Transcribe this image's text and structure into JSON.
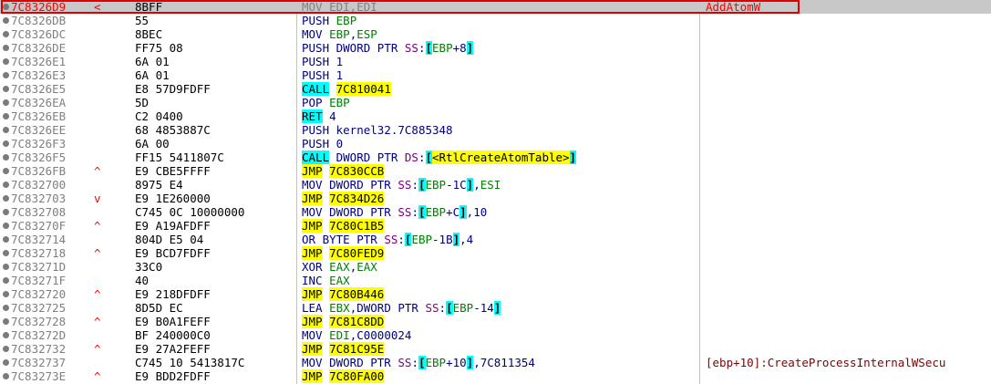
{
  "disassembly": {
    "rows": [
      {
        "addr": "7C8326D9",
        "arrow": "<",
        "bytes": "8BFF",
        "instr": "MOV EDI,EDI",
        "comment": "AddAtomW",
        "selected": true
      },
      {
        "addr": "7C8326DB",
        "arrow": "",
        "bytes": "55",
        "instr": "PUSH EBP",
        "comment": ""
      },
      {
        "addr": "7C8326DC",
        "arrow": "",
        "bytes": "8BEC",
        "instr": "MOV EBP,ESP",
        "comment": ""
      },
      {
        "addr": "7C8326DE",
        "arrow": "",
        "bytes": "FF75 08",
        "instr": "PUSH DWORD PTR SS:[EBP+8]",
        "comment": ""
      },
      {
        "addr": "7C8326E1",
        "arrow": "",
        "bytes": "6A 01",
        "instr": "PUSH 1",
        "comment": ""
      },
      {
        "addr": "7C8326E3",
        "arrow": "",
        "bytes": "6A 01",
        "instr": "PUSH 1",
        "comment": ""
      },
      {
        "addr": "7C8326E5",
        "arrow": "",
        "bytes": "E8 57D9FDFF",
        "instr": "CALL 7C810041",
        "comment": ""
      },
      {
        "addr": "7C8326EA",
        "arrow": "",
        "bytes": "5D",
        "instr": "POP EBP",
        "comment": ""
      },
      {
        "addr": "7C8326EB",
        "arrow": "",
        "bytes": "C2 0400",
        "instr": "RET 4",
        "comment": ""
      },
      {
        "addr": "7C8326EE",
        "arrow": "",
        "bytes": "68 4853887C",
        "instr": "PUSH kernel32.7C885348",
        "comment": ""
      },
      {
        "addr": "7C8326F3",
        "arrow": "",
        "bytes": "6A 00",
        "instr": "PUSH 0",
        "comment": ""
      },
      {
        "addr": "7C8326F5",
        "arrow": "",
        "bytes": "FF15 5411807C",
        "instr": "CALL DWORD PTR DS:[<RtlCreateAtomTable>]",
        "comment": ""
      },
      {
        "addr": "7C8326FB",
        "arrow": "^",
        "bytes": "E9 CBE5FFFF",
        "instr": "JMP 7C830CCB",
        "comment": ""
      },
      {
        "addr": "7C832700",
        "arrow": "",
        "bytes": "8975 E4",
        "instr": "MOV DWORD PTR SS:[EBP-1C],ESI",
        "comment": ""
      },
      {
        "addr": "7C832703",
        "arrow": "v",
        "bytes": "E9 1E260000",
        "instr": "JMP 7C834D26",
        "comment": ""
      },
      {
        "addr": "7C832708",
        "arrow": "",
        "bytes": "C745 0C 10000000",
        "instr": "MOV DWORD PTR SS:[EBP+C],10",
        "comment": ""
      },
      {
        "addr": "7C83270F",
        "arrow": "^",
        "bytes": "E9 A19AFDFF",
        "instr": "JMP 7C80C1B5",
        "comment": ""
      },
      {
        "addr": "7C832714",
        "arrow": "",
        "bytes": "804D E5 04",
        "instr": "OR BYTE PTR SS:[EBP-1B],4",
        "comment": ""
      },
      {
        "addr": "7C832718",
        "arrow": "^",
        "bytes": "E9 BCD7FDFF",
        "instr": "JMP 7C80FED9",
        "comment": ""
      },
      {
        "addr": "7C83271D",
        "arrow": "",
        "bytes": "33C0",
        "instr": "XOR EAX,EAX",
        "comment": ""
      },
      {
        "addr": "7C83271F",
        "arrow": "",
        "bytes": "40",
        "instr": "INC EAX",
        "comment": ""
      },
      {
        "addr": "7C832720",
        "arrow": "^",
        "bytes": "E9 218DFDFF",
        "instr": "JMP 7C80B446",
        "comment": ""
      },
      {
        "addr": "7C832725",
        "arrow": "",
        "bytes": "8D5D EC",
        "instr": "LEA EBX,DWORD PTR SS:[EBP-14]",
        "comment": ""
      },
      {
        "addr": "7C832728",
        "arrow": "^",
        "bytes": "E9 B0A1FEFF",
        "instr": "JMP 7C81C8DD",
        "comment": ""
      },
      {
        "addr": "7C83272D",
        "arrow": "",
        "bytes": "BF 240000C0",
        "instr": "MOV EDI,C0000024",
        "comment": ""
      },
      {
        "addr": "7C832732",
        "arrow": "^",
        "bytes": "E9 27A2FEFF",
        "instr": "JMP 7C81C95E",
        "comment": ""
      },
      {
        "addr": "7C832737",
        "arrow": "",
        "bytes": "C745 10 5413817C",
        "instr": "MOV DWORD PTR SS:[EBP+10],7C811354",
        "comment": "[ebp+10]:CreateProcessInternalWSecu"
      },
      {
        "addr": "7C83273E",
        "arrow": "^",
        "bytes": "E9 BDD2FDFF",
        "instr": "JMP 7C80FA00",
        "comment": ""
      }
    ]
  }
}
